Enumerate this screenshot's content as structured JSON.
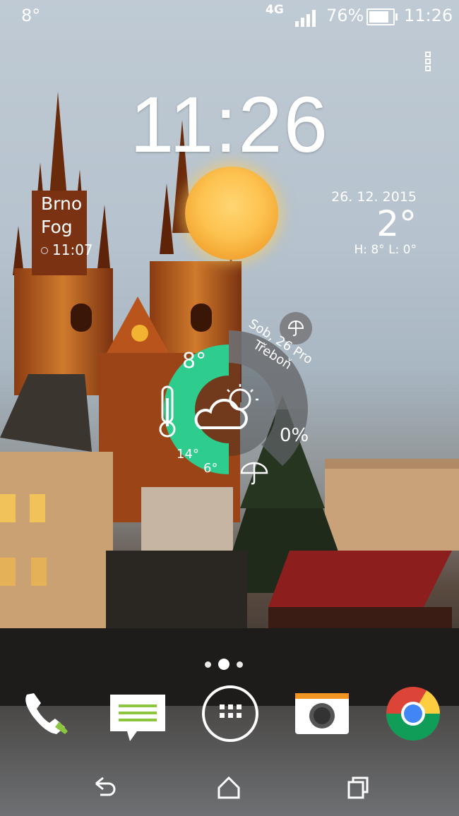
{
  "status_bar": {
    "left_temp": "8°",
    "network": "4G",
    "battery_percent": "76%",
    "battery_level": 0.76,
    "time": "11:26"
  },
  "clock": {
    "time": "11:26"
  },
  "location": {
    "city": "Brno",
    "condition": "Fog",
    "updated_time": "11:07"
  },
  "right_weather": {
    "date": "26. 12. 2015",
    "temperature": "2°",
    "high_low": "H: 8° L: 0°"
  },
  "widget": {
    "current_temp": "8°",
    "high": "14°",
    "low": "6°",
    "rain_chance": "0%",
    "date_line1": "Sob, 26 Pro",
    "date_line2": "Třeboň"
  },
  "page_indicator": {
    "count": 3,
    "active": 2
  },
  "dock": [
    {
      "name": "phone-icon"
    },
    {
      "name": "messages-icon"
    },
    {
      "name": "app-drawer-icon"
    },
    {
      "name": "camera-icon"
    },
    {
      "name": "chrome-icon"
    }
  ],
  "colors": {
    "widget_green": "#2ecc8d",
    "widget_ring": "#6d6f72",
    "dock_accent": "#8bc63e"
  }
}
